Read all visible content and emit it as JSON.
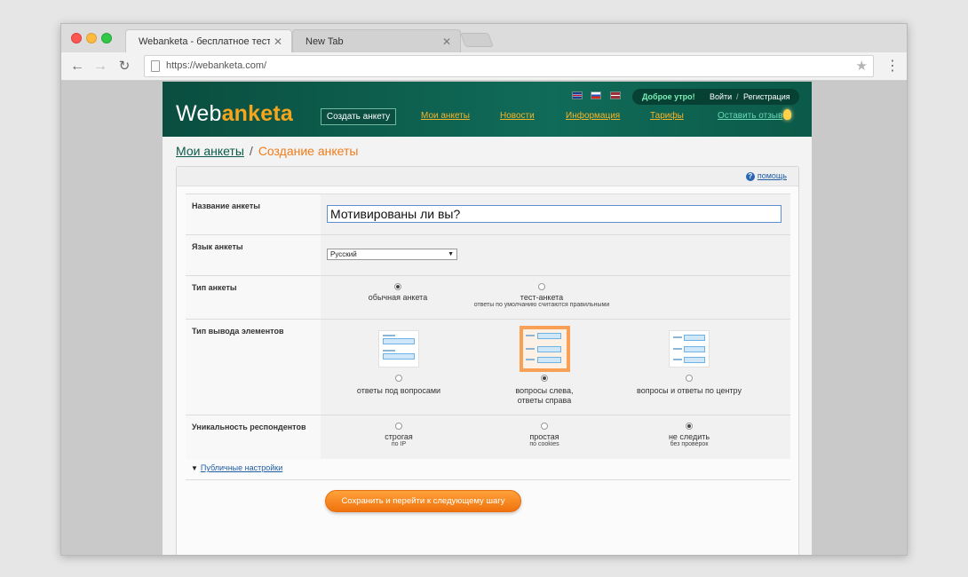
{
  "browser": {
    "tabs": [
      {
        "title": "Webanketa - бесплатное тестир…"
      },
      {
        "title": "New Tab"
      }
    ],
    "url": "https://webanketa.com/"
  },
  "site": {
    "logo": {
      "part1": "Web",
      "part2": "anketa"
    },
    "greeting": "Доброе утро!",
    "login": "Войти",
    "separator": "/",
    "register": "Регистрация",
    "create_button": "Создать анкету",
    "nav": [
      "Мои анкеты",
      "Новости",
      "Информация",
      "Тарифы",
      "Оставить отзыв"
    ],
    "flags": [
      "flag-uk-icon",
      "flag-ru-icon",
      "flag-lv-icon"
    ]
  },
  "breadcrumb": {
    "parent": "Мои анкеты",
    "separator": "/",
    "current": "Создание анкеты"
  },
  "form": {
    "help": "помощь",
    "name_label": "Название анкеты",
    "name_value": "Мотивированы ли вы?",
    "lang_label": "Язык анкеты",
    "lang_value": "Русский",
    "type_label": "Тип анкеты",
    "type_options": [
      {
        "label": "обычная анкета",
        "sub": "",
        "selected": true
      },
      {
        "label": "тест-анкета",
        "sub": "ответы по умолчанию считаются правильными",
        "selected": false
      }
    ],
    "layout_label": "Тип вывода элементов",
    "layout_options": [
      {
        "label": "ответы под вопросами",
        "label2": "",
        "selected": false
      },
      {
        "label": "вопросы слева,",
        "label2": "ответы справа",
        "selected": true
      },
      {
        "label": "вопросы и ответы по центру",
        "label2": "",
        "selected": false
      }
    ],
    "unique_label": "Уникальность респондентов",
    "unique_options": [
      {
        "label": "строгая",
        "sub": "по IP",
        "selected": false
      },
      {
        "label": "простая",
        "sub": "по cookies",
        "selected": false
      },
      {
        "label": "не следить",
        "sub": "без проверок",
        "selected": true
      }
    ],
    "public_settings": "Публичные настройки",
    "save_button": "Сохранить и перейти к следующему шагу"
  },
  "colors": {
    "header_green": "#0b5545",
    "accent_orange": "#f07c1a",
    "link_blue": "#1f5da3"
  }
}
